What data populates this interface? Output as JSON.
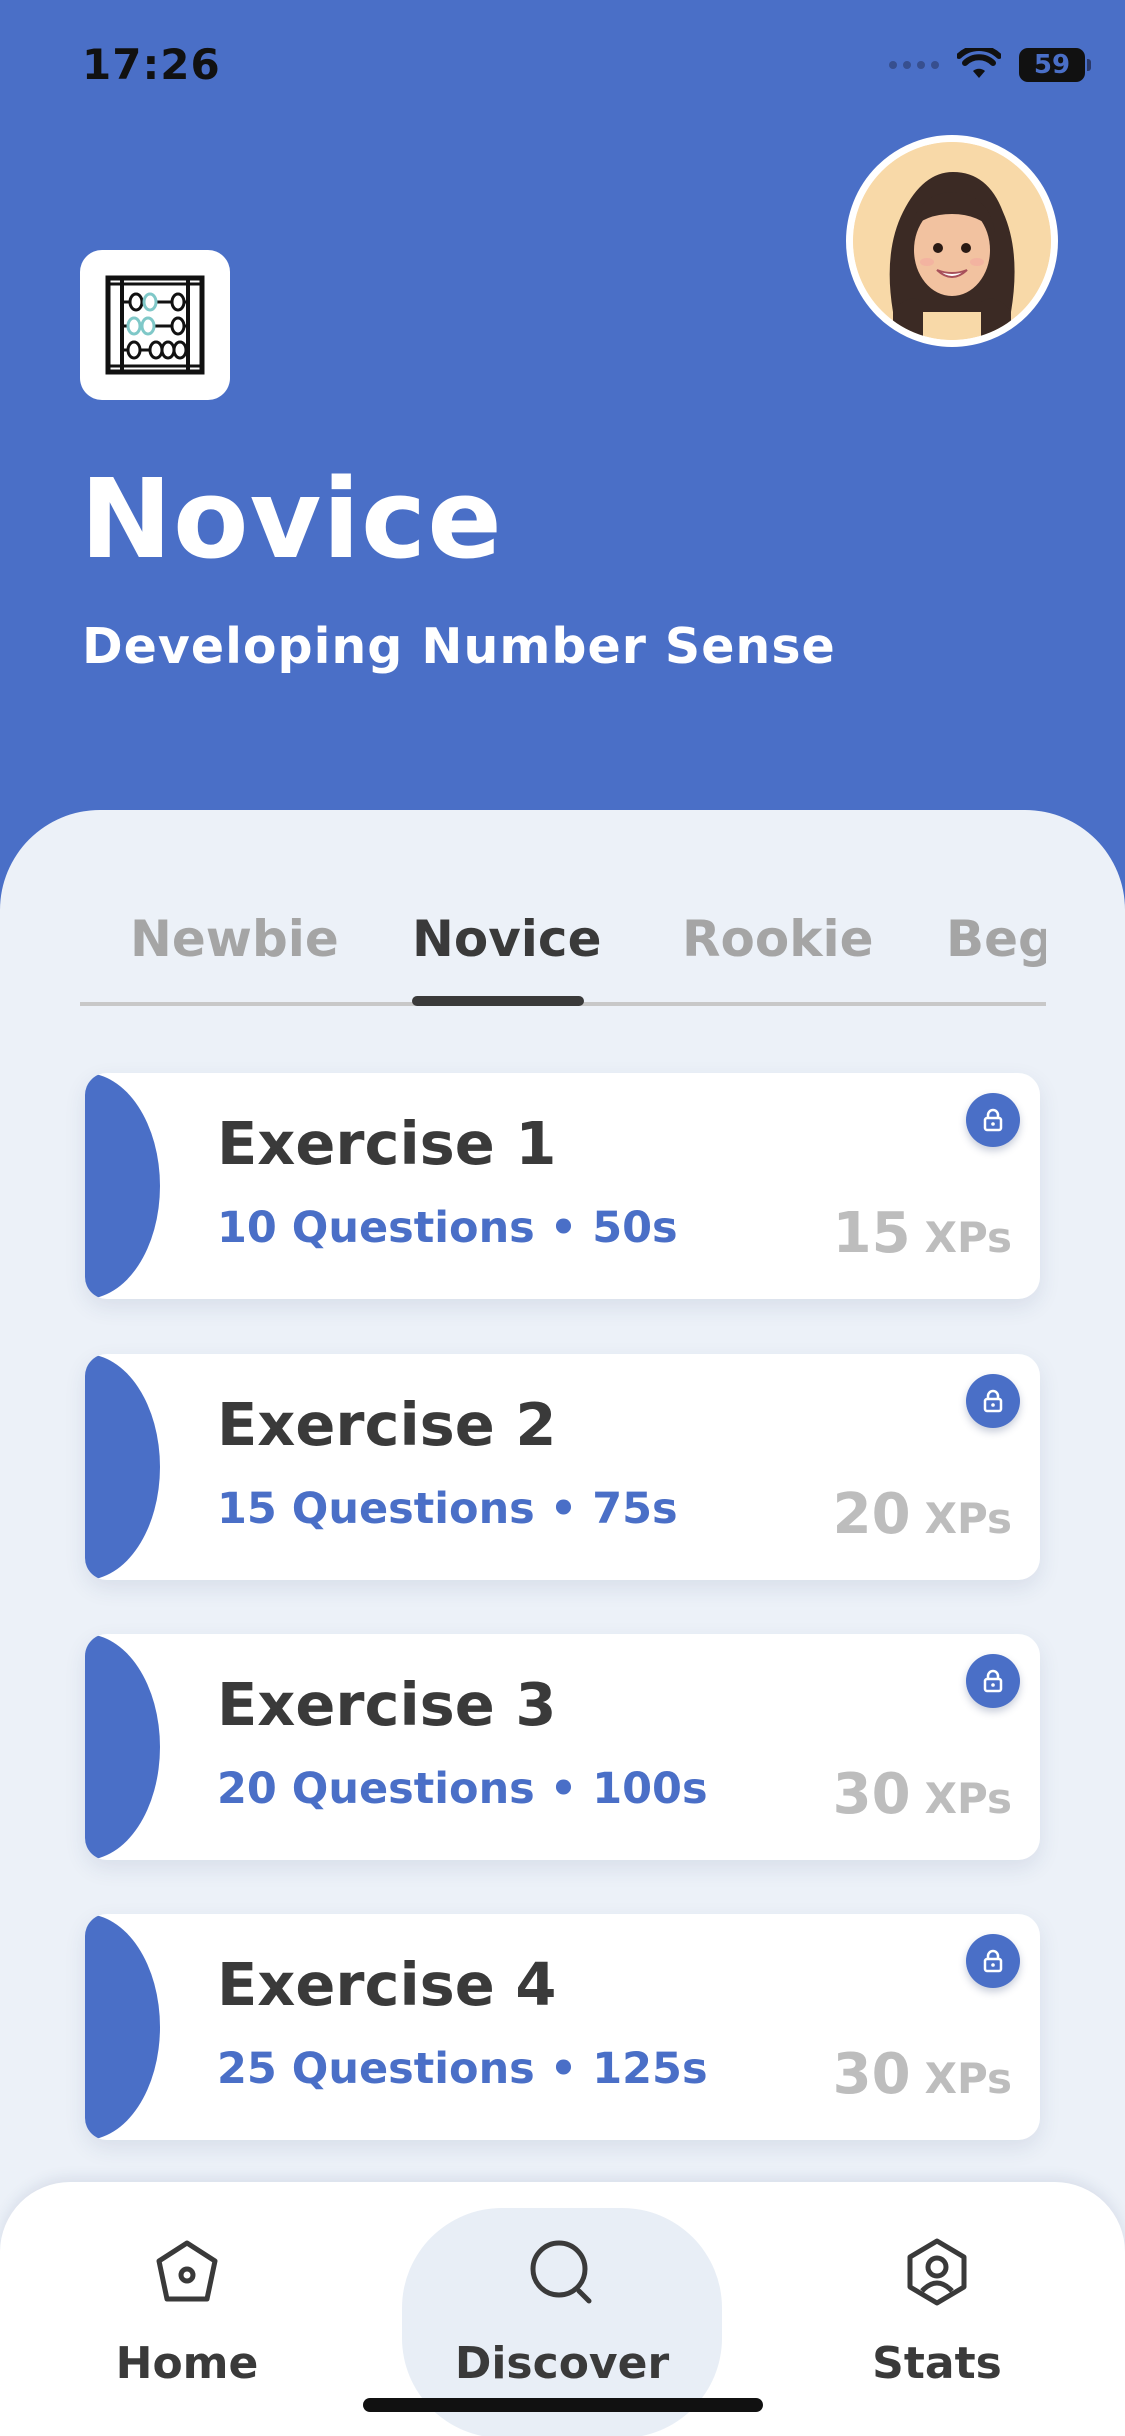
{
  "status_bar": {
    "time": "17:26",
    "battery": "59",
    "icons": [
      "signal-dots-icon",
      "wifi-icon",
      "battery-icon"
    ]
  },
  "header": {
    "title": "Novice",
    "subtitle": "Developing Number Sense",
    "logo_icon": "abacus-icon",
    "avatar_icon": "memoji-avatar"
  },
  "tabs": [
    {
      "label": "Newbie",
      "active": false
    },
    {
      "label": "Novice",
      "active": true
    },
    {
      "label": "Rookie",
      "active": false
    },
    {
      "label": "Begi",
      "active": false
    }
  ],
  "exercises": [
    {
      "title": "Exercise 1",
      "meta": "10 Questions • 50s",
      "xp": "15",
      "xp_unit": "XPs",
      "locked": true
    },
    {
      "title": "Exercise 2",
      "meta": "15 Questions • 75s",
      "xp": "20",
      "xp_unit": "XPs",
      "locked": true
    },
    {
      "title": "Exercise 3",
      "meta": "20 Questions • 100s",
      "xp": "30",
      "xp_unit": "XPs",
      "locked": true
    },
    {
      "title": "Exercise 4",
      "meta": "25 Questions • 125s",
      "xp": "30",
      "xp_unit": "XPs",
      "locked": true
    }
  ],
  "nav": [
    {
      "label": "Home",
      "icon": "home-icon",
      "active": false
    },
    {
      "label": "Discover",
      "icon": "search-icon",
      "active": true
    },
    {
      "label": "Stats",
      "icon": "profile-icon",
      "active": false
    }
  ],
  "colors": {
    "primary": "#4a6fc7",
    "sheet": "#ecf1f8",
    "text_dark": "#3a3a3a",
    "text_muted": "#a5a5a5",
    "xp_gray": "#bdbdbd"
  }
}
